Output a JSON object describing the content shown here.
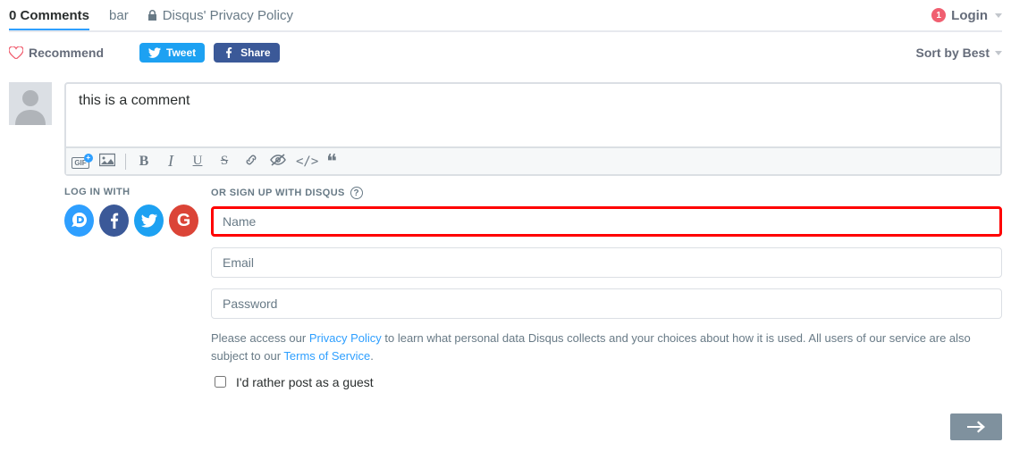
{
  "header": {
    "comments_label": "0 Comments",
    "bar_label": "bar",
    "privacy_label": "Disqus' Privacy Policy",
    "login_label": "Login",
    "login_count": "1"
  },
  "actions": {
    "recommend": "Recommend",
    "tweet": "Tweet",
    "share": "Share",
    "sort": "Sort by Best"
  },
  "editor": {
    "text": "this is a comment"
  },
  "login_with": {
    "label": "LOG IN WITH"
  },
  "signup": {
    "label": "OR SIGN UP WITH DISQUS",
    "name_placeholder": "Name",
    "email_placeholder": "Email",
    "password_placeholder": "Password",
    "policy_pre": "Please access our ",
    "policy_link": "Privacy Policy",
    "policy_mid": " to learn what personal data Disqus collects and your choices about how it is used. All users of our service are also subject to our ",
    "tos_link": "Terms of Service",
    "policy_end": ".",
    "guest_label": "I'd rather post as a guest"
  }
}
